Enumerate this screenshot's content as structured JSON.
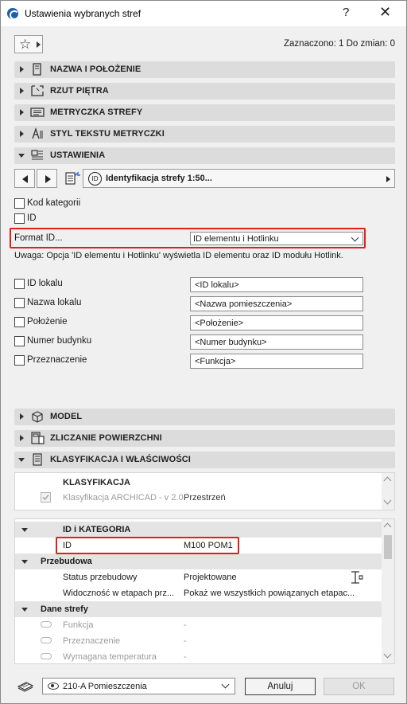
{
  "window": {
    "title": "Ustawienia wybranych stref",
    "help": "?",
    "close": "✕"
  },
  "toolbar": {
    "star": "☆",
    "counter": "Zaznaczono: 1 Do zmian: 0"
  },
  "sections": {
    "name_position": "NAZWA I POŁOŻENIE",
    "floor_plan": "RZUT PIĘTRA",
    "zone_stamp": "METRYCZKA STREFY",
    "stamp_text_style": "STYL TEKSTU METRYCZKI",
    "settings": "USTAWIENIA",
    "model": "MODEL",
    "area_calc": "ZLICZANIE POWIERZCHNI",
    "classification": "KLASYFIKACJA I WŁAŚCIWOŚCI"
  },
  "settings_nav": {
    "page_label": "Identyfikacja strefy 1:50..."
  },
  "settings_panel": {
    "category_code": "Kod kategorii",
    "id": "ID",
    "format_label": "Format ID...",
    "format_value": "ID elementu i Hotlinku",
    "note": "Uwaga: Opcja 'ID elementu i Hotlinku' wyświetla ID elementu oraz ID modułu Hotlink.",
    "fields": [
      {
        "label": "ID lokalu",
        "value": "<ID lokalu>"
      },
      {
        "label": "Nazwa lokalu",
        "value": "<Nazwa pomieszczenia>"
      },
      {
        "label": "Położenie",
        "value": "<Położenie>"
      },
      {
        "label": "Numer budynku",
        "value": "<Numer budynku>"
      },
      {
        "label": "Przeznaczenie",
        "value": "<Funkcja>"
      }
    ]
  },
  "classification_panel": {
    "header": "KLASYFIKACJA",
    "system": "Klasyfikacja ARCHICAD - v 2.0",
    "value": "Przestrzeń"
  },
  "properties_panel": {
    "id_group": "ID i KATEGORIA",
    "id_key": "ID",
    "id_value": "M100 POM1",
    "renovation_group": "Przebudowa",
    "status_key": "Status przebudowy",
    "status_value": "Projektowane",
    "visibility_key": "Widoczność w etapach prz...",
    "visibility_value": "Pokaż we wszystkich powiązanych etapac...",
    "zone_group": "Dane strefy",
    "zone_rows": [
      {
        "key": "Funkcja",
        "value": "-"
      },
      {
        "key": "Przeznaczenie",
        "value": "-"
      },
      {
        "key": "Wymagana temperatura",
        "value": "-"
      }
    ]
  },
  "footer": {
    "layer": "210-A Pomieszczenia",
    "cancel": "Anuluj",
    "ok": "OK"
  }
}
